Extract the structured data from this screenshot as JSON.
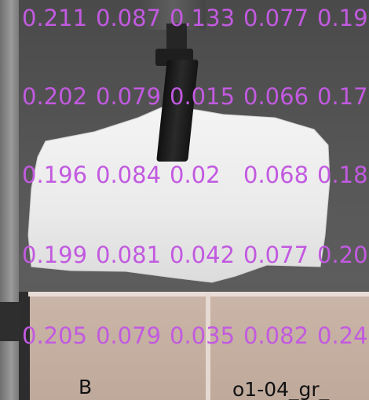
{
  "grid_values": [
    [
      "0.211",
      "0.087",
      "0.133",
      "0.077",
      "0.19"
    ],
    [
      "0.202",
      "0.079",
      "0.015",
      "0.066",
      "0.17"
    ],
    [
      "0.196",
      "0.084",
      "0.02",
      "0.068",
      "0.18"
    ],
    [
      "0.199",
      "0.081",
      "0.042",
      "0.077",
      "0.20"
    ],
    [
      "0.205",
      "0.079",
      "0.035",
      "0.082",
      "0.24"
    ]
  ],
  "corner_labels": {
    "left": "B",
    "right": "o1-04_gr_"
  },
  "colors": {
    "overlay_text": "#c25ae0",
    "corner_text": "#111111"
  }
}
